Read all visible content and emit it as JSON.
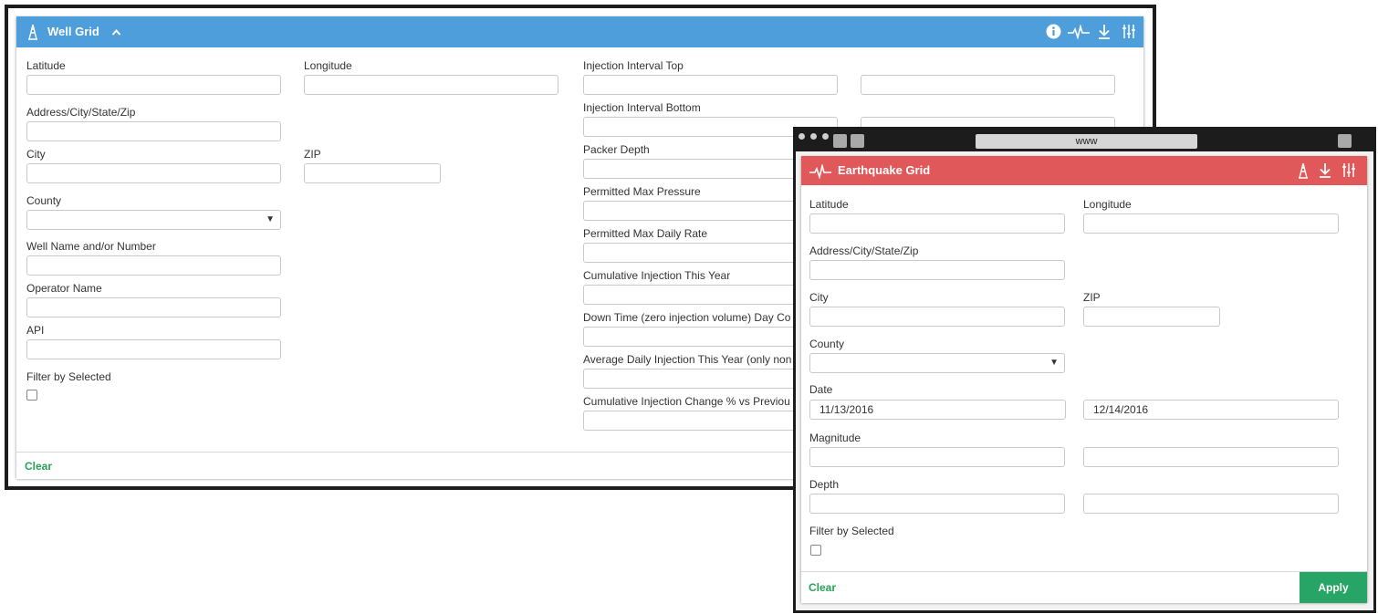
{
  "well_grid": {
    "title": "Well Grid",
    "icons": [
      "oil-derrick-icon",
      "chevron-up-icon",
      "info-icon",
      "seismic-icon",
      "download-icon",
      "sliders-icon"
    ],
    "colors": {
      "header": "#4e9edb",
      "clear": "#2aa158"
    },
    "labels": {
      "latitude": "Latitude",
      "longitude": "Longitude",
      "address": "Address/City/State/Zip",
      "city": "City",
      "zip": "ZIP",
      "county": "County",
      "well_name": "Well Name and/or Number",
      "operator": "Operator Name",
      "api": "API",
      "filter_selected": "Filter by Selected",
      "injection_top": "Injection Interval Top",
      "injection_bottom": "Injection Interval Bottom",
      "packer_depth": "Packer Depth",
      "max_pressure": "Permitted Max Pressure",
      "max_daily_rate": "Permitted Max Daily Rate",
      "cum_injection": "Cumulative Injection This Year",
      "down_time": "Down Time (zero injection volume) Day Co",
      "avg_daily": "Average Daily Injection This Year (only non",
      "cum_change": "Cumulative Injection Change % vs Previou"
    },
    "clear_label": "Clear"
  },
  "eq_window": {
    "url": "www"
  },
  "eq_grid": {
    "title": "Earthquake Grid",
    "icons": [
      "seismic-icon",
      "oil-derrick-icon",
      "download-icon",
      "sliders-icon"
    ],
    "colors": {
      "header": "#e0585a",
      "apply": "#27a566",
      "clear": "#2aa158"
    },
    "labels": {
      "latitude": "Latitude",
      "longitude": "Longitude",
      "address": "Address/City/State/Zip",
      "city": "City",
      "zip": "ZIP",
      "county": "County",
      "date": "Date",
      "magnitude": "Magnitude",
      "depth": "Depth",
      "filter_selected": "Filter by Selected"
    },
    "date_from": "11/13/2016",
    "date_to": "12/14/2016",
    "clear_label": "Clear",
    "apply_label": "Apply"
  }
}
